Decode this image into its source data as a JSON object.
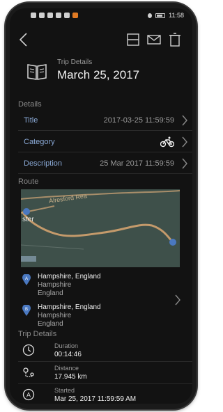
{
  "status_bar": {
    "time": "11:58"
  },
  "header": {
    "subtitle": "Trip Details",
    "title": "March 25, 2017"
  },
  "details": {
    "section": "Details",
    "rows": [
      {
        "label": "Title",
        "value": "2017-03-25 11:59:59"
      },
      {
        "label": "Category",
        "value": "",
        "icon": "bicycle-icon"
      },
      {
        "label": "Description",
        "value": "25 Mar 2017 11:59:59"
      }
    ]
  },
  "route": {
    "section": "Route",
    "map_labels": {
      "road": "Alresford Rea",
      "place": "ster"
    },
    "start": {
      "marker": "A",
      "line1": "Hampshire, England",
      "line2": "Hampshire",
      "line3": "England"
    },
    "end": {
      "marker": "B",
      "line1": "Hampshire, England",
      "line2": "Hampshire",
      "line3": "England"
    }
  },
  "trip_details": {
    "section": "Trip Details",
    "items": [
      {
        "key": "Duration",
        "value": "00:14:46",
        "icon": "clock-icon"
      },
      {
        "key": "Distance",
        "value": "17.945 km",
        "icon": "route-distance-icon"
      },
      {
        "key": "Started",
        "value": "Mar 25, 2017 11:59:59 AM",
        "icon": "start-marker-icon"
      }
    ]
  }
}
